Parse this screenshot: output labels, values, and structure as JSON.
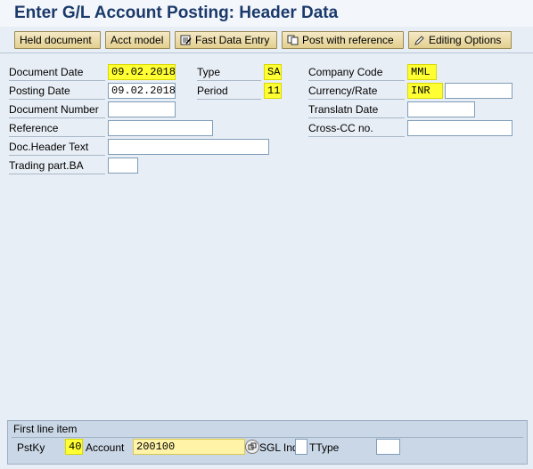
{
  "window": {
    "title": "Enter G/L Account Posting: Header Data"
  },
  "toolbar": {
    "held_document": "Held document",
    "acct_model": "Acct model",
    "fast_data_entry": "Fast Data Entry",
    "post_with_reference": "Post with reference",
    "editing_options": "Editing Options"
  },
  "header": {
    "document_date": {
      "label": "Document Date",
      "value": "09.02.2018"
    },
    "posting_date": {
      "label": "Posting Date",
      "value": "09.02.2018"
    },
    "document_number": {
      "label": "Document Number",
      "value": ""
    },
    "reference": {
      "label": "Reference",
      "value": ""
    },
    "doc_header_text": {
      "label": "Doc.Header Text",
      "value": ""
    },
    "trading_part_ba": {
      "label": "Trading part.BA",
      "value": ""
    },
    "type": {
      "label": "Type",
      "value": "SA"
    },
    "period": {
      "label": "Period",
      "value": "11"
    },
    "company_code": {
      "label": "Company Code",
      "value": "MML"
    },
    "currency_rate": {
      "label": "Currency/Rate",
      "value": "INR",
      "rate": ""
    },
    "translatn_date": {
      "label": "Translatn Date",
      "value": ""
    },
    "cross_cc_no": {
      "label": "Cross-CC no.",
      "value": ""
    }
  },
  "first_line_item": {
    "title": "First line item",
    "pstky": {
      "label": "PstKy",
      "value": "40"
    },
    "account": {
      "label": "Account",
      "value": "200100"
    },
    "sgl_ind": {
      "label": "SGL Ind",
      "value": ""
    },
    "ttype": {
      "label": "TType",
      "value": ""
    }
  },
  "colors": {
    "highlight": "#ffff33",
    "background": "#e8eef5",
    "title": "#1b3a6b"
  }
}
